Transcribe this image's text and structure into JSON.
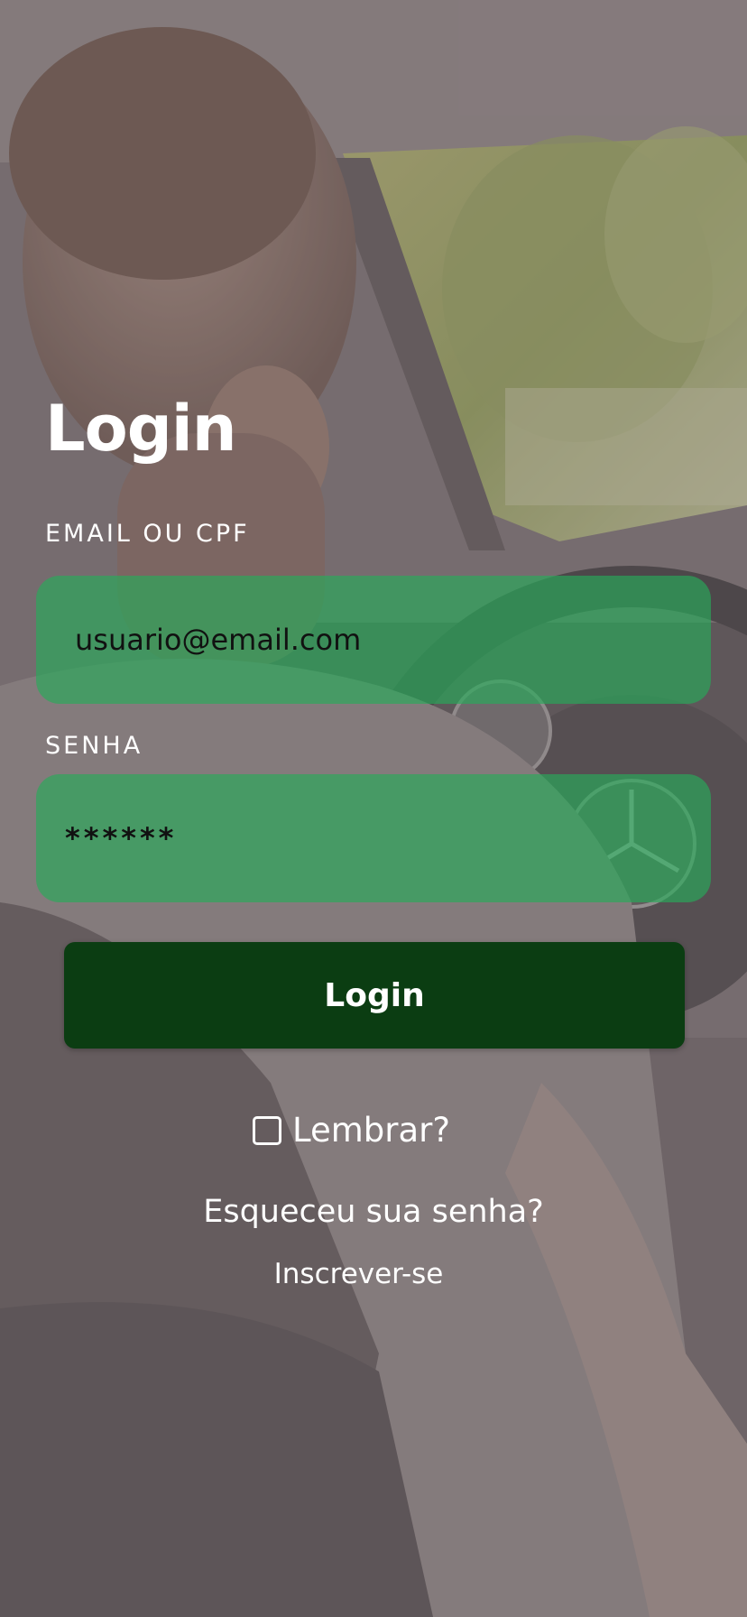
{
  "login_form": {
    "title": "Login",
    "email": {
      "label": "EMAIL OU CPF",
      "value": "usuario@email.com"
    },
    "password": {
      "label": "SENHA",
      "value": "******"
    },
    "submit_label": "Login",
    "remember": {
      "label": "Lembrar?",
      "checked": false
    },
    "forgot_password_label": "Esqueceu sua senha?",
    "signup_label": "Inscrever-se"
  },
  "colors": {
    "input_fill": "#28aa5a",
    "button_fill": "#0b3d12",
    "text": "#ffffff"
  },
  "icons": {
    "background": "car-interior-photo"
  }
}
